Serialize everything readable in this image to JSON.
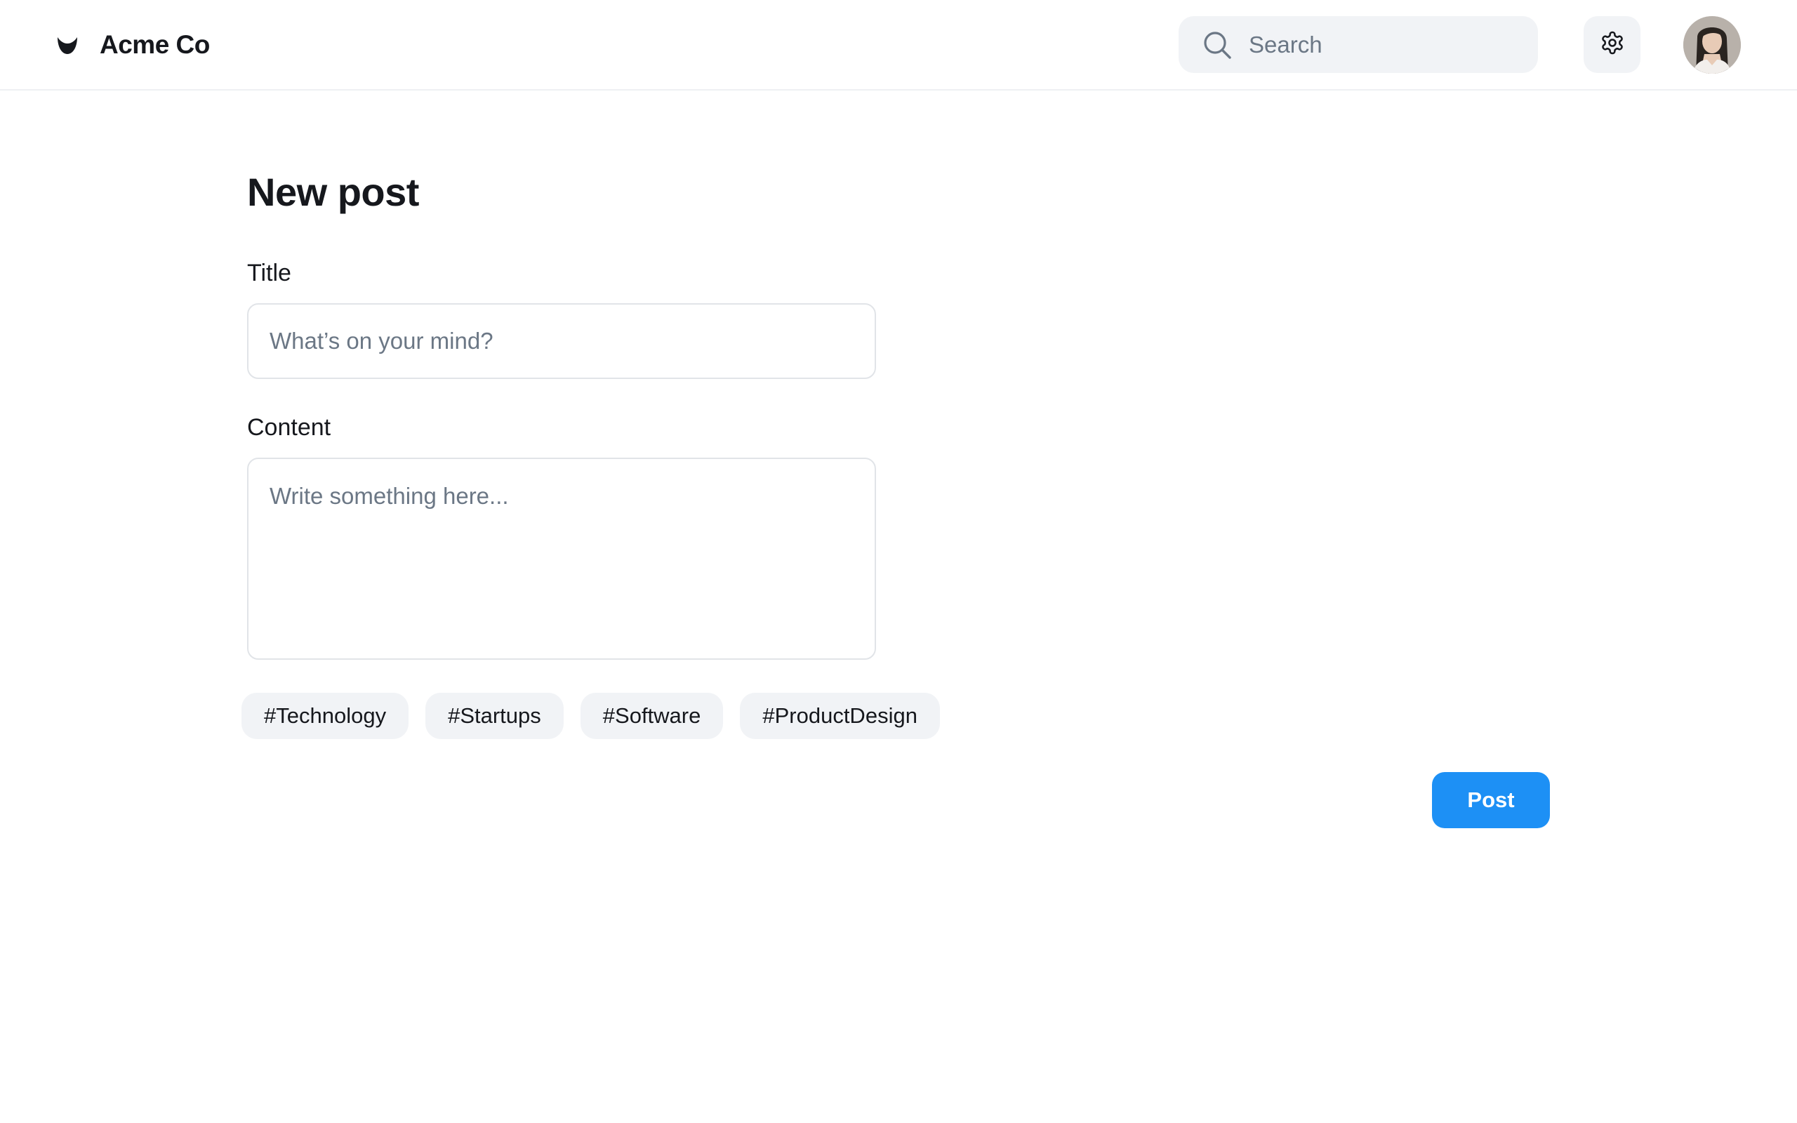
{
  "header": {
    "brand_name": "Acme Co",
    "brand_icon": "acme-logo-icon",
    "search_placeholder": "Search",
    "search_icon": "search-icon",
    "settings_icon": "gear-icon",
    "avatar_icon": "user-avatar"
  },
  "main": {
    "page_title": "New post",
    "title_label": "Title",
    "title_placeholder": "What’s on your mind?",
    "content_label": "Content",
    "content_placeholder": "Write something here...",
    "tags": [
      "#Technology",
      "#Startups",
      "#Software",
      "#ProductDesign"
    ],
    "post_label": "Post"
  },
  "colors": {
    "accent": "#1d90f5",
    "pill_background": "#f1f3f6",
    "border": "#e1e4e8",
    "text": "#16181d",
    "placeholder": "#6b7785"
  }
}
